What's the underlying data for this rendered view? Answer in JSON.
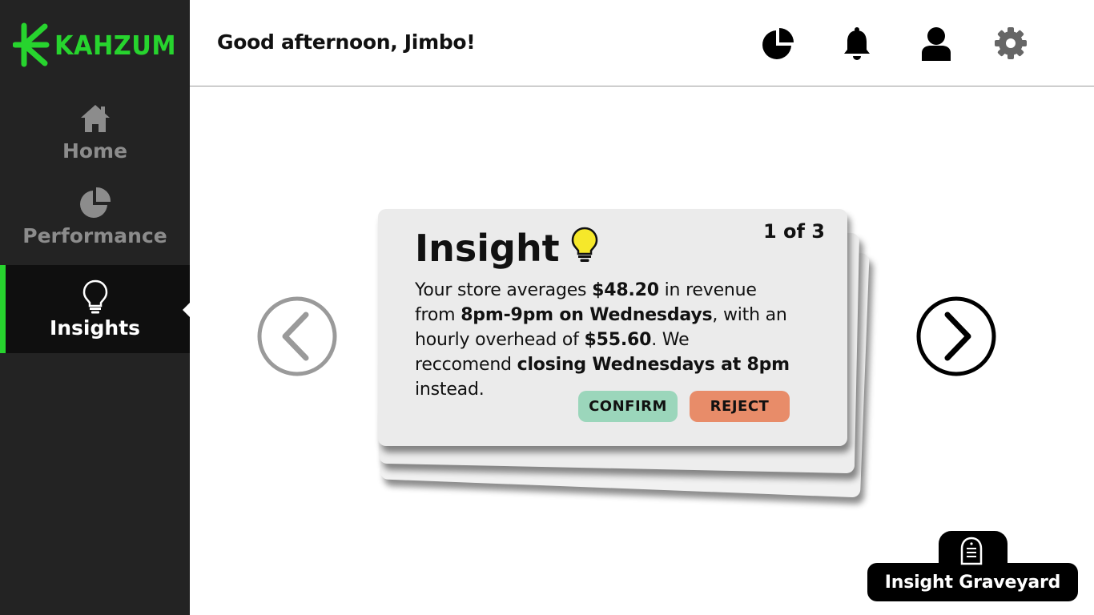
{
  "app": {
    "brand": "KAHZUM",
    "brand_color": "#27d42e"
  },
  "sidebar": {
    "items": [
      {
        "label": "Home",
        "icon": "home-icon"
      },
      {
        "label": "Performance",
        "icon": "pie-chart-icon"
      },
      {
        "label": "Insights",
        "icon": "lightbulb-icon",
        "active": true
      }
    ]
  },
  "header": {
    "greeting": "Good afternoon, Jimbo!",
    "icons": [
      "pie-chart-icon",
      "bell-icon",
      "user-icon",
      "gear-icon"
    ]
  },
  "insight": {
    "title": "Insight",
    "counter": "1 of 3",
    "body": {
      "t1": "Your store averages ",
      "b1": "$48.20",
      "t2": " in revenue from ",
      "b2": "8pm-9pm on Wednesdays",
      "t3": ", with an hourly overhead of ",
      "b3": "$55.60",
      "t4": ". We reccomend ",
      "b4": "closing Wednesdays at 8pm",
      "t5": " instead."
    },
    "confirm_label": "CONFIRM",
    "reject_label": "REJECT"
  },
  "navigation": {
    "prev": "chevron-left-icon",
    "next": "chevron-right-icon"
  },
  "graveyard": {
    "label": "Insight Graveyard",
    "icon": "tombstone-icon"
  }
}
